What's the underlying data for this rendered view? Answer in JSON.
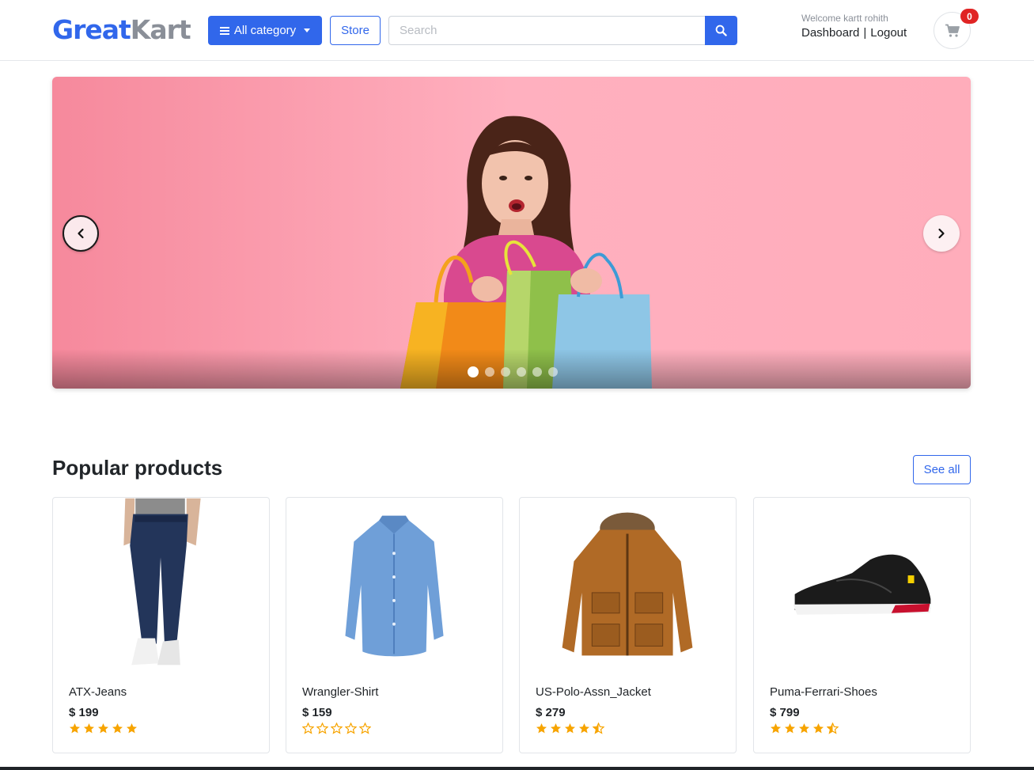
{
  "header": {
    "logo_part1": "Great",
    "logo_part2": "Kart",
    "category_label": "All category",
    "store_label": "Store",
    "search_placeholder": "Search",
    "welcome": "Welcome kartt rohith",
    "dashboard_label": "Dashboard",
    "separator": "|",
    "logout_label": "Logout",
    "cart_count": "0"
  },
  "carousel": {
    "slide_count": 6,
    "active_index": 0
  },
  "section": {
    "title": "Popular products",
    "see_all_label": "See all"
  },
  "products": [
    {
      "name": "ATX-Jeans",
      "price": "$ 199",
      "rating": 5,
      "image_icon": "jeans-image"
    },
    {
      "name": "Wrangler-Shirt",
      "price": "$ 159",
      "rating": 0,
      "image_icon": "shirt-image"
    },
    {
      "name": "US-Polo-Assn_Jacket",
      "price": "$ 279",
      "rating": 4.5,
      "image_icon": "jacket-image"
    },
    {
      "name": "Puma-Ferrari-Shoes",
      "price": "$ 799",
      "rating": 4.5,
      "image_icon": "shoe-image"
    }
  ],
  "colors": {
    "accent": "#3167eb",
    "star": "#f7a400",
    "badge": "#e02424",
    "banner_pink": "#ffb0bf"
  }
}
